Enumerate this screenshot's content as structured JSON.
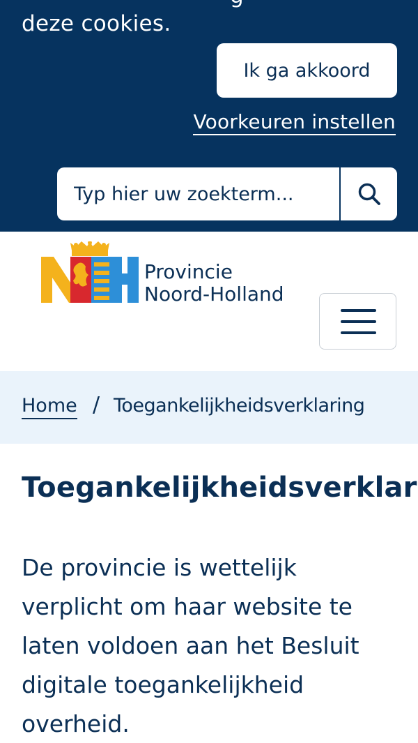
{
  "cookie_banner": {
    "text_cut_line": "g",
    "text": "deze cookies.",
    "accept_label": "Ik ga akkoord",
    "preferences_label": "Voorkeuren instellen",
    "background_color": "#06335f"
  },
  "search": {
    "placeholder": "Typ hier uw zoekterm...",
    "button_icon": "search-icon"
  },
  "header": {
    "logo_line1": "Provincie",
    "logo_line2": "Noord-Holland",
    "menu_icon": "hamburger-icon"
  },
  "breadcrumb": {
    "home_label": "Home",
    "separator": "/",
    "current_label": "Toegankelijkheidsverklaring"
  },
  "main": {
    "title": "Toegankelijkheidsverklaring",
    "intro": "De provincie is wettelijk verplicht om haar website te laten voldoen aan het Besluit digitale toegankelijkheid overheid."
  },
  "colors": {
    "navy": "#06335f",
    "text": "#0b2f55",
    "breadcrumb_bg": "#eaf3fb",
    "logo_yellow": "#f4b21c",
    "logo_blue": "#2d8fd8",
    "logo_red": "#d8282e"
  }
}
